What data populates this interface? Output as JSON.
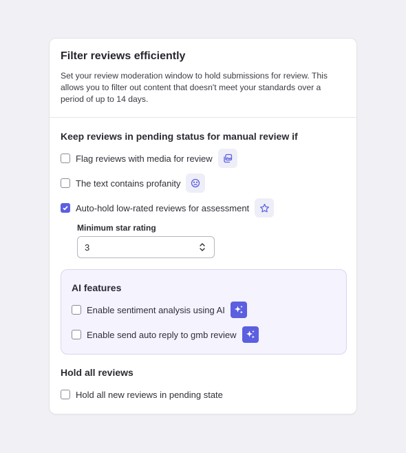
{
  "card": {
    "title": "Filter reviews efficiently",
    "description": "Set your review moderation window to hold submissions for review. This allows you to filter out content that doesn't meet your standards over a period of up to 14 days."
  },
  "pending": {
    "title": "Keep reviews in pending status for manual review if",
    "options": [
      {
        "label": "Flag reviews with media for review",
        "checked": false,
        "icon": "media-gallery-icon"
      },
      {
        "label": "The text contains profanity",
        "checked": false,
        "icon": "frown-face-icon"
      },
      {
        "label": "Auto-hold low-rated reviews for assessment",
        "checked": true,
        "icon": "star-icon"
      }
    ],
    "min_rating": {
      "label": "Minimum star rating",
      "value": "3"
    }
  },
  "ai": {
    "title": "AI features",
    "options": [
      {
        "label": "Enable sentiment analysis using AI",
        "checked": false,
        "icon": "sparkle-icon"
      },
      {
        "label": "Enable send auto reply to gmb review",
        "checked": false,
        "icon": "sparkle-icon"
      }
    ]
  },
  "hold_all": {
    "title": "Hold all reviews",
    "option": {
      "label": "Hold all new reviews in pending state",
      "checked": false
    }
  },
  "colors": {
    "accent": "#5b5fe0",
    "chip_bg": "#eeeef8",
    "ai_bg": "#f5f3fe"
  }
}
